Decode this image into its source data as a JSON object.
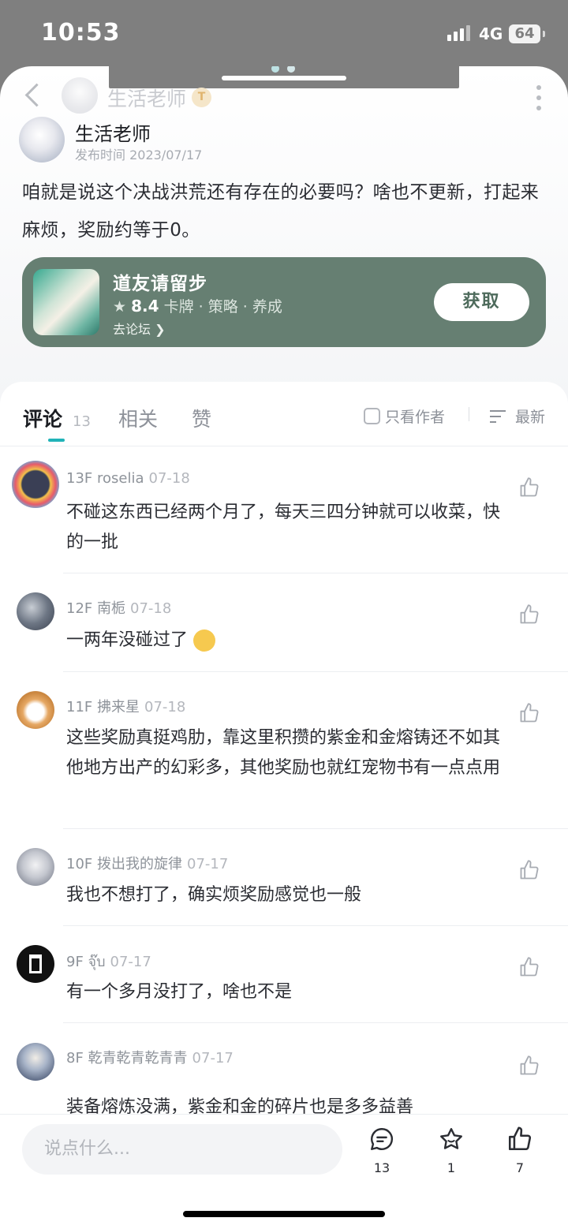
{
  "status_bar": {
    "time": "10:53",
    "network": "4G",
    "battery": "64"
  },
  "header": {
    "username": "生活老师",
    "badge": "T"
  },
  "post": {
    "author": "生活老师",
    "publish_time": "发布时间 2023/07/17",
    "content": "咱就是说这个决战洪荒还有存在的必要吗？啥也不更新，打起来麻烦，奖励约等于0。"
  },
  "game_card": {
    "title": "道友请留步",
    "rating": "8.4",
    "tags": "卡牌 · 策略 · 养成",
    "forum_link": "去论坛",
    "get_button": "获取"
  },
  "tabs": {
    "comments": "评论",
    "comments_count": "13",
    "related": "相关",
    "likes": "赞",
    "only_author": "只看作者",
    "sort": "最新"
  },
  "comments": [
    {
      "floor": "13F",
      "user": "roselia",
      "date": "07-18",
      "text": "不碰这东西已经两个月了，每天三四分钟就可以收菜，快的一批"
    },
    {
      "floor": "12F",
      "user": "南栀",
      "date": "07-18",
      "text": "一两年没碰过了"
    },
    {
      "floor": "11F",
      "user": "拂来星",
      "date": "07-18",
      "text": "这些奖励真挺鸡肋，靠这里积攒的紫金和金熔铸还不如其他地方出产的幻彩多，其他奖励也就红宠物书有一点点用"
    },
    {
      "floor": "10F",
      "user": "拨出我的旋律",
      "date": "07-17",
      "text": "我也不想打了，确实烦奖励感觉也一般"
    },
    {
      "floor": "9F",
      "user": "จุ๊บ",
      "date": "07-17",
      "text": "有一个多月没打了，啥也不是"
    },
    {
      "floor": "8F",
      "user": "乾青乾青乾青青",
      "date": "07-17",
      "text": "装备熔炼没满，紫金和金的碎片也是多多益善"
    }
  ],
  "bottom_bar": {
    "input_placeholder": "说点什么...",
    "comment_count": "13",
    "favorite_count": "1",
    "like_count": "7"
  },
  "colors": {
    "accent": "#21b3b8",
    "card": "#667f72",
    "status_bar": "#7f7f7f"
  }
}
